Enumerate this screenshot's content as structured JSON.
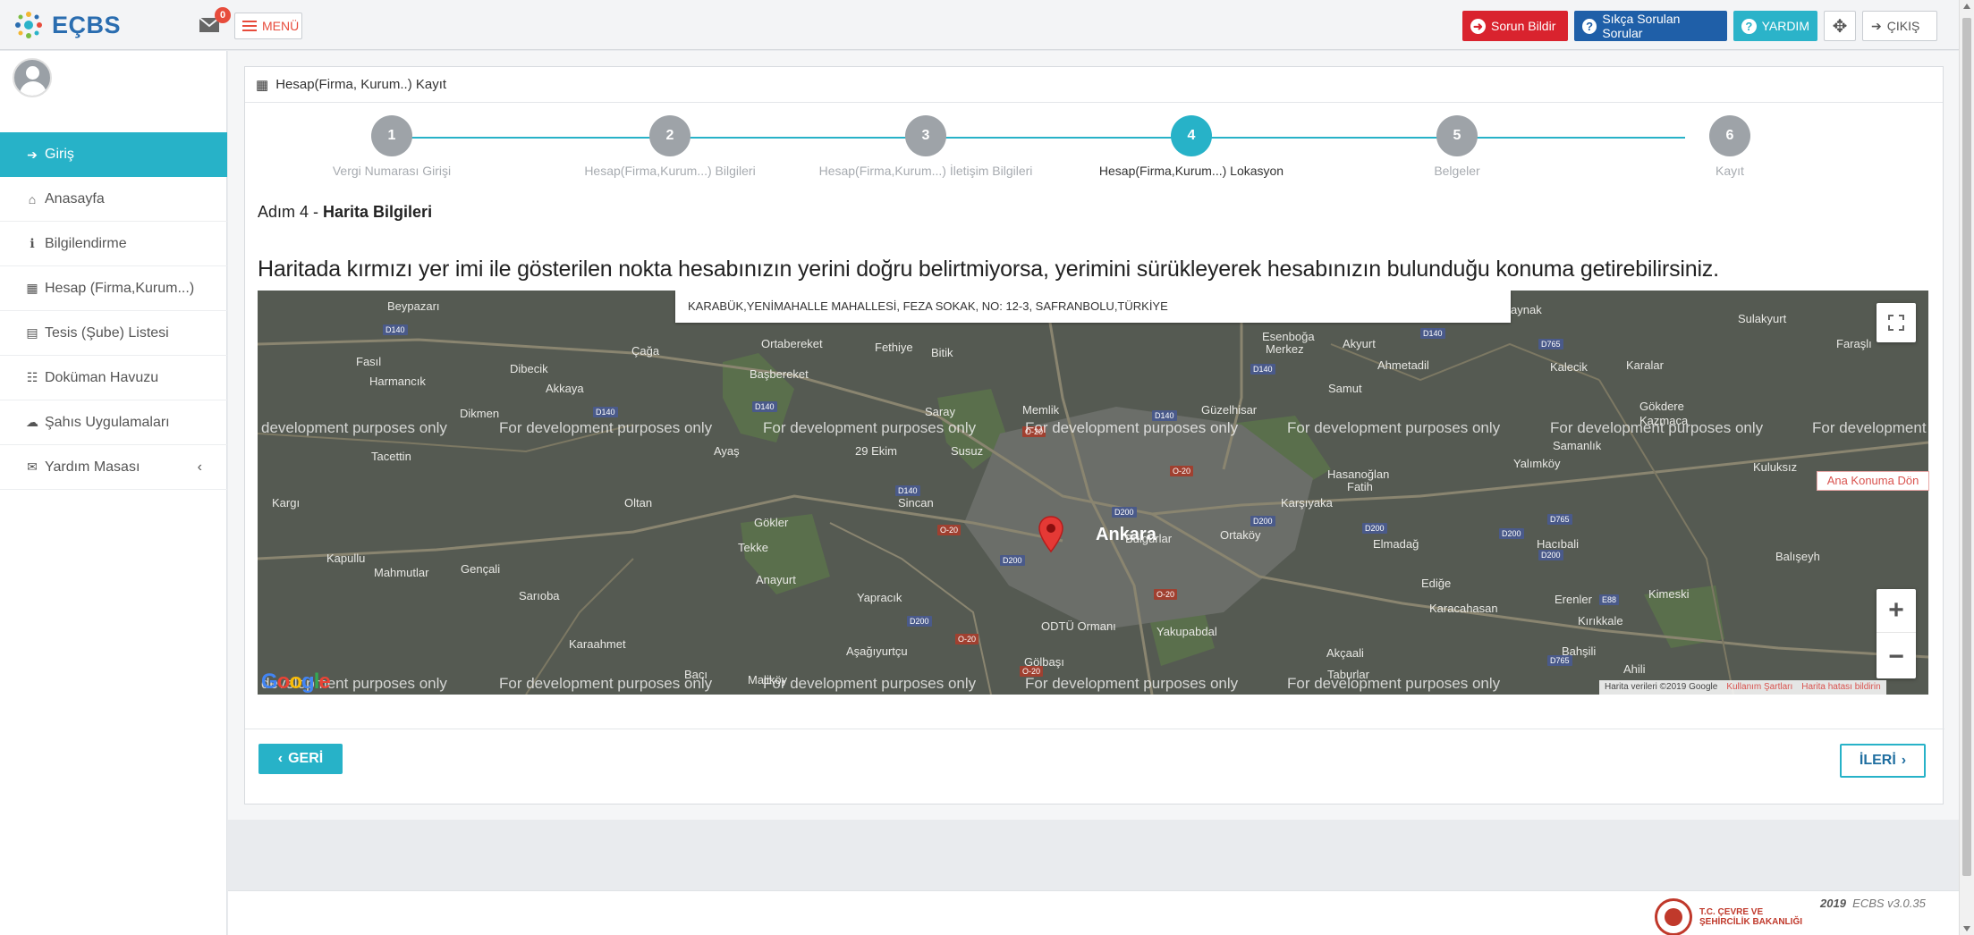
{
  "app": {
    "logo_text": "EÇBS",
    "messages_count": "0",
    "menu_label": "MENÜ"
  },
  "topbar": {
    "report_issue": "Sorun Bildir",
    "faq": "Sıkça Sorulan Sorular",
    "help": "YARDIM",
    "exit": "ÇIKIŞ"
  },
  "sidebar": {
    "items": [
      {
        "label": "Giriş",
        "icon": "sign-in-icon",
        "glyph": "➔"
      },
      {
        "label": "Anasayfa",
        "icon": "home-icon",
        "glyph": "⌂"
      },
      {
        "label": "Bilgilendirme",
        "icon": "info-icon",
        "glyph": "ℹ"
      },
      {
        "label": "Hesap (Firma,Kurum...)",
        "icon": "building-icon",
        "glyph": "▦"
      },
      {
        "label": "Tesis (Şube) Listesi",
        "icon": "clipboard-icon",
        "glyph": "▤"
      },
      {
        "label": "Doküman Havuzu",
        "icon": "users-icon",
        "glyph": "☷"
      },
      {
        "label": "Şahıs Uygulamaları",
        "icon": "cloud-icon",
        "glyph": "☁"
      },
      {
        "label": "Yardım Masası",
        "icon": "envelope-icon",
        "glyph": "✉"
      }
    ]
  },
  "panel": {
    "title": "Hesap(Firma, Kurum..) Kayıt"
  },
  "wizard": {
    "active_step": 4,
    "steps": [
      {
        "number": "1",
        "label": "Vergi Numarası Girişi"
      },
      {
        "number": "2",
        "label": "Hesap(Firma,Kurum...) Bilgileri"
      },
      {
        "number": "3",
        "label": "Hesap(Firma,Kurum...) İletişim Bilgileri"
      },
      {
        "number": "4",
        "label": "Hesap(Firma,Kurum...) Lokasyon"
      },
      {
        "number": "5",
        "label": "Belgeler"
      },
      {
        "number": "6",
        "label": "Kayıt"
      }
    ]
  },
  "step": {
    "prefix": "Adım 4 - ",
    "title": "Harita Bilgileri",
    "instruction": "Haritada kırmızı yer imi ile gösterilen nokta hesabınızın yerini doğru belirtmiyorsa, yerimini sürükleyerek hesabınızın bulunduğu konuma getirebilirsiniz."
  },
  "map": {
    "address": "KARABÜK,YENİMAHALLE MAHALLESİ, FEZA SOKAK, NO: 12-3, SAFRANBOLU,TÜRKİYE",
    "dev_watermark": "For development purposes only",
    "dev_watermark_cut": "development purposes only",
    "dev_watermark_end": "For development",
    "attribution": "Harita verileri ©2019 Google",
    "terms": "Kullanım Şartları",
    "report_error": "Harita hatası bildirin",
    "home_button": "Ana Konuma Dön",
    "google_logo": "Google",
    "places": {
      "beypazari": "Beypazarı",
      "caga": "Çağa",
      "ortabereket": "Ortabereket",
      "fethiye": "Fethiye",
      "bitik": "Bitik",
      "esenboga": "Esenboğa",
      "merkez": "Merkez",
      "akyurt": "Akyurt",
      "kaynak": "aynak",
      "sulakyurt": "Sulakyurt",
      "farasli": "Faraşlı",
      "fasil": "Fasıl",
      "dibecik": "Dibecik",
      "basbereket": "Başbereket",
      "ahmetadil": "Ahmetadil",
      "kalecik": "Kalecik",
      "karalar": "Karalar",
      "harmancik": "Harmancık",
      "akkaya": "Akkaya",
      "samut": "Samut",
      "dikmen": "Dikmen",
      "saray": "Saray",
      "memlik": "Memlik",
      "guzelhisar": "Güzelhisar",
      "gokdere": "Gökdere",
      "kazmaca": "Kazmaca",
      "ayas": "Ayaş",
      "ekim": "29 Ekim",
      "susuz": "Susuz",
      "samanlik": "Samanlık",
      "tacettin": "Tacettin",
      "hasanoglan": "Hasanoğlan",
      "fatih": "Fatih",
      "yalimkoy": "Yalımköy",
      "kuluksiz": "Kuluksız",
      "kargi": "Kargı",
      "oltan": "Oltan",
      "sincan": "Sincan",
      "karsiyaka": "Karşıyaka",
      "gokler": "Gökler",
      "ankara": "Ankara",
      "ortakoy": "Ortaköy",
      "elmadag": "Elmadağ",
      "hacibali": "Hacıbali",
      "tekke": "Tekke",
      "baliseyh": "Balışeyh",
      "kapullu": "Kapullu",
      "mahmutlar": "Mahmutlar",
      "gencali": "Gençali",
      "anayurt": "Anayurt",
      "edige": "Ediğe",
      "sariboa": "Sarıoba",
      "yapracik": "Yapracık",
      "karacahasan": "Karacahasan",
      "erenler": "Erenler",
      "kimeski": "Kimeski",
      "kirikkale": "Kırıkkale",
      "odtu": "ODTÜ Ormanı",
      "yakupabdal": "Yakupabdal",
      "karaahmet": "Karaahmet",
      "asagiyurtcu": "Aşağıyurtçu",
      "akcaali": "Akçaali",
      "bahsili": "Bahşili",
      "ahili": "Ahili",
      "golbasi": "Gölbaşı",
      "baci": "Bacı",
      "malikoy": "Maliköy",
      "taburlar": "Taburlar",
      "bulgurlar": "Bulgurlar"
    }
  },
  "footer": {
    "back": "GERİ",
    "next": "İLERİ",
    "year": "2019",
    "version": "ECBS v3.0.35",
    "ministry_line1": "T.C. ÇEVRE VE",
    "ministry_line2": "ŞEHİRCİLİK BAKANLIĞI"
  },
  "colors": {
    "accent": "#27b2c8",
    "danger": "#d9232e",
    "brand_blue": "#1f5fa8",
    "marker": "#e53935"
  }
}
